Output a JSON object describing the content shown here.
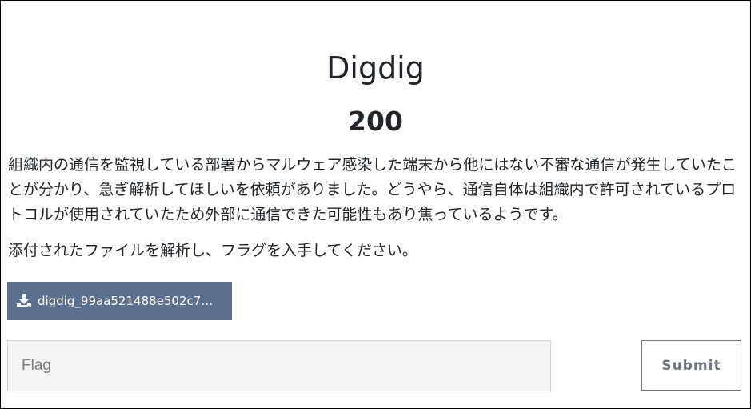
{
  "challenge": {
    "title": "Digdig",
    "points": "200",
    "description": "組織内の通信を監視している部署からマルウェア感染した端末から他にはない不審な通信が発生していたことが分かり、急ぎ解析してほしいを依頼がありました。どうやら、通信自体は組織内で許可されているプロトコルが使用されていたため外部に通信できた可能性もあり焦っているようです。",
    "instruction": "添付されたファイルを解析し、フラグを入手してください。"
  },
  "attachment": {
    "label": "digdig_99aa521488e502c7…",
    "icon": "download-icon",
    "color": "#5b708f"
  },
  "form": {
    "flag_placeholder": "Flag",
    "flag_value": "",
    "submit_label": "Submit"
  }
}
